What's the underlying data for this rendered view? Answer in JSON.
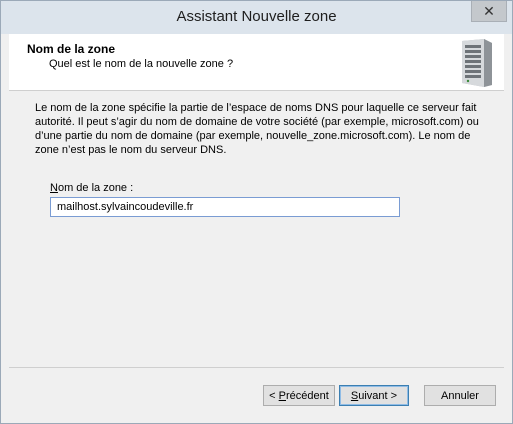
{
  "window": {
    "title": "Assistant Nouvelle zone",
    "close_glyph": "✕"
  },
  "header": {
    "title": "Nom de la zone",
    "subtitle": "Quel est le nom de la nouvelle zone ?",
    "icon": "server-icon"
  },
  "body": {
    "description": "Le nom de la zone spécifie la partie de l’espace de noms DNS pour laquelle ce serveur fait autorité. Il peut s’agir du nom de domaine de votre société (par exemple, microsoft.com) ou d’une partie du nom de domaine (par exemple, nouvelle_zone.microsoft.com). Le nom de zone n’est pas le nom du serveur DNS.",
    "zone_name_label": "Nom de la zone :",
    "zone_name_value": "mailhost.sylvaincoudeville.fr"
  },
  "buttons": {
    "previous": "< Précédent",
    "next": "Suivant >",
    "cancel": "Annuler"
  }
}
